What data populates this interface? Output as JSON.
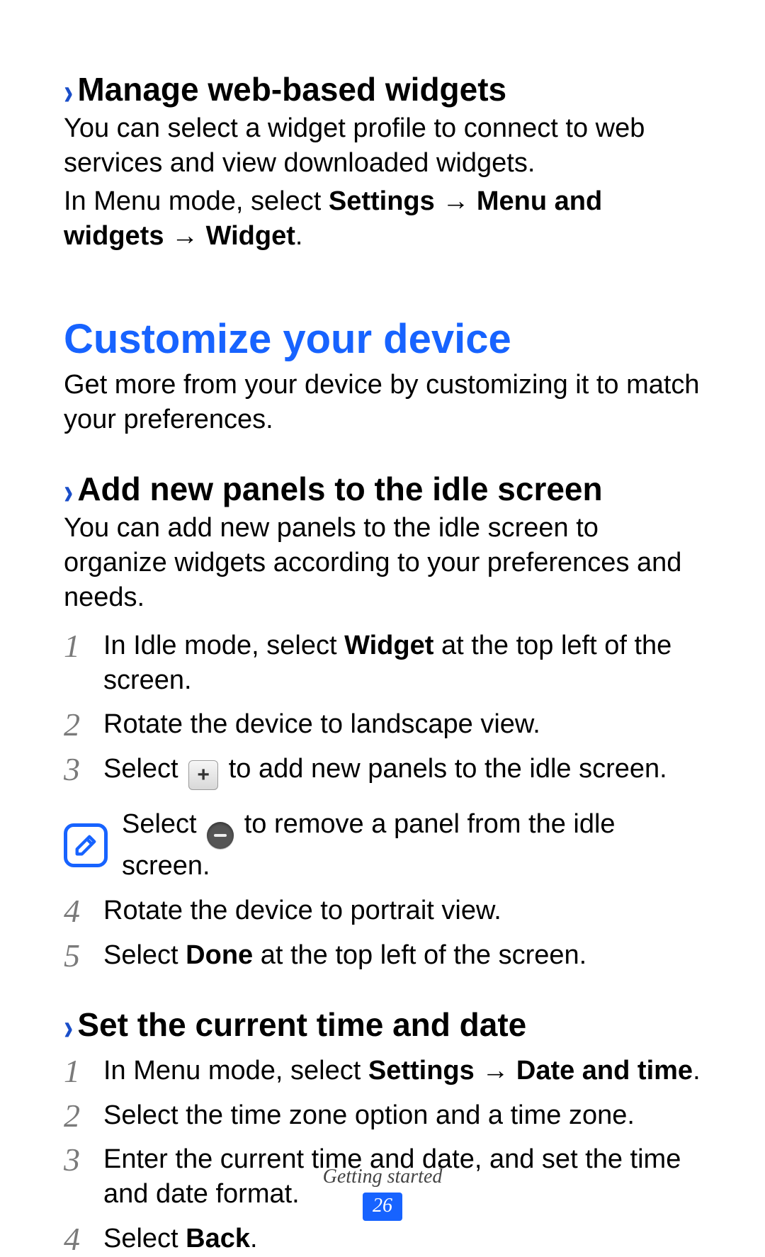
{
  "section1": {
    "heading": "Manage web-based widgets",
    "p1": "You can select a widget profile to connect to web services and view downloaded widgets.",
    "p2_pre": "In Menu mode, select ",
    "p2_bold": "Settings → Menu and widgets → Widget",
    "p2_post": "."
  },
  "main_heading": "Customize your device",
  "main_sub": "Get more from your device by customizing it to match your preferences.",
  "section2": {
    "heading": "Add new panels to the idle screen",
    "intro": "You can add new panels to the idle screen to organize widgets according to your preferences and needs.",
    "steps": {
      "s1_pre": "In Idle mode, select ",
      "s1_bold": "Widget",
      "s1_post": " at the top left of the screen.",
      "s2": "Rotate the device to landscape view.",
      "s3_pre": "Select ",
      "s3_post": " to add new panels to the idle screen.",
      "note_pre": "Select ",
      "note_post": " to remove a panel from the idle screen.",
      "s4": "Rotate the device to portrait view.",
      "s5_pre": "Select ",
      "s5_bold": "Done",
      "s5_post": " at the top left of the screen."
    }
  },
  "section3": {
    "heading": "Set the current time and date",
    "steps": {
      "s1_pre": "In Menu mode, select ",
      "s1_bold": "Settings → Date and time",
      "s1_post": ".",
      "s2": "Select the time zone option and a time zone.",
      "s3": "Enter the current time and date, and set the time and date format.",
      "s4_pre": "Select ",
      "s4_bold": "Back",
      "s4_post": "."
    }
  },
  "nums": {
    "n1": "1",
    "n2": "2",
    "n3": "3",
    "n4": "4",
    "n5": "5"
  },
  "footer": {
    "chapter": "Getting started",
    "page": "26"
  }
}
